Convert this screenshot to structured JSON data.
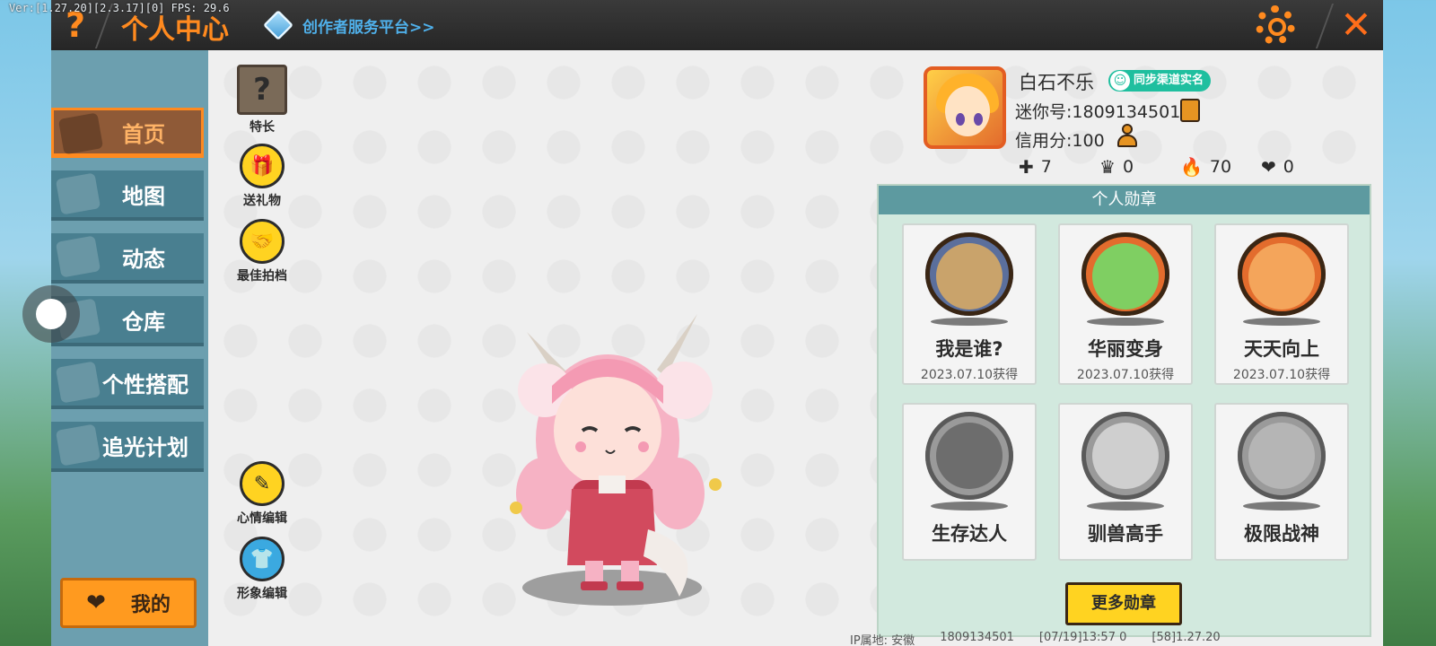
{
  "debug": "Ver:[1.27.20][2.3.17][0] FPS: 29.6",
  "header": {
    "help_glyph": "?",
    "title": "个人中心",
    "creator_link": "创作者服务平台>>",
    "close_glyph": "✕"
  },
  "sidebar": {
    "items": [
      {
        "label": "首页",
        "icon": "house-icon",
        "active": true
      },
      {
        "label": "地图",
        "icon": "map-icon"
      },
      {
        "label": "动态",
        "icon": "bell-icon"
      },
      {
        "label": "仓库",
        "icon": "box-icon"
      },
      {
        "label": "个性搭配",
        "icon": "outfit-icon"
      },
      {
        "label": "追光计划",
        "icon": "light-icon"
      }
    ],
    "mine_label": "我的"
  },
  "tools": {
    "skill": "特长",
    "gift": "送礼物",
    "partner": "最佳拍档",
    "mood": "心情编辑",
    "look": "形象编辑"
  },
  "profile": {
    "name": "白石不乐",
    "verify": "同步渠道实名",
    "mini_id": "迷你号:1809134501",
    "credit": "信用分:100",
    "stats": [
      {
        "icon": "plus-box-icon",
        "glyph": "✚",
        "value": "7"
      },
      {
        "icon": "podium-icon",
        "glyph": "♛",
        "value": "0"
      },
      {
        "icon": "flame-icon",
        "glyph": "🔥",
        "value": "70"
      },
      {
        "icon": "heart-broken-icon",
        "glyph": "❤",
        "value": "0"
      }
    ]
  },
  "badges": {
    "title": "个人勋章",
    "items": [
      {
        "name": "我是谁?",
        "date": "2023.07.10获得",
        "color": "#5b6f9c",
        "inner": "#c9a36b",
        "earned": true
      },
      {
        "name": "华丽变身",
        "date": "2023.07.10获得",
        "color": "#e36c2d",
        "inner": "#7fcf62",
        "earned": true
      },
      {
        "name": "天天向上",
        "date": "2023.07.10获得",
        "color": "#e36c2d",
        "inner": "#f4a55b",
        "earned": true
      },
      {
        "name": "生存达人",
        "date": "",
        "color": "#9a9a9a",
        "inner": "#6d6d6d",
        "earned": false
      },
      {
        "name": "驯兽高手",
        "date": "",
        "color": "#9a9a9a",
        "inner": "#cfcfcf",
        "earned": false
      },
      {
        "name": "极限战神",
        "date": "",
        "color": "#9a9a9a",
        "inner": "#b5b5b5",
        "earned": false
      }
    ],
    "more_label": "更多勋章"
  },
  "footer": {
    "ip": "IP属地: 安徽",
    "uid": "1809134501",
    "time": "[07/19]13:57 0",
    "ver": "[58]1.27.20"
  }
}
